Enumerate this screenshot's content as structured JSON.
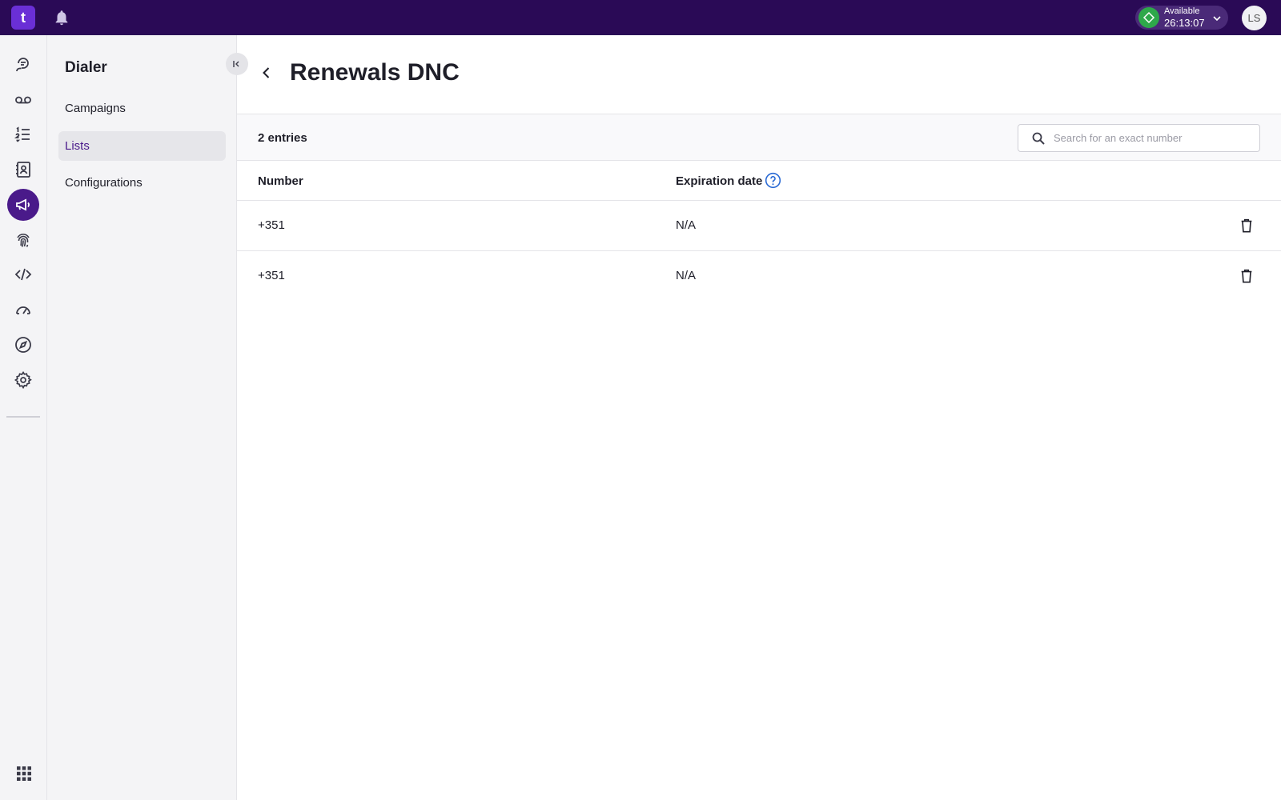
{
  "topbar": {
    "logo_text": "t",
    "status": {
      "label": "Available",
      "timer": "26:13:07",
      "color": "#2ea84a"
    },
    "avatar_initials": "LS",
    "brand_color": "#2a0a56",
    "icons": [
      "bell-icon",
      "chevron-down-icon"
    ]
  },
  "rail": {
    "items": [
      {
        "name": "conversations-icon",
        "active": false
      },
      {
        "name": "voicemail-icon",
        "active": false
      },
      {
        "name": "lists-icon",
        "active": false
      },
      {
        "name": "contacts-icon",
        "active": false
      },
      {
        "name": "dialer-megaphone-icon",
        "active": true
      },
      {
        "name": "fingerprint-icon",
        "active": false
      },
      {
        "name": "code-icon",
        "active": false
      },
      {
        "name": "dashboard-gauge-icon",
        "active": false
      },
      {
        "name": "compass-icon",
        "active": false
      },
      {
        "name": "settings-gear-icon",
        "active": false
      }
    ],
    "bottom_icon": "apps-grid-icon",
    "active_color": "#4a1a8a"
  },
  "sidebar": {
    "title": "Dialer",
    "items": [
      {
        "label": "Campaigns",
        "active": false
      },
      {
        "label": "Lists",
        "active": true
      },
      {
        "label": "Configurations",
        "active": false
      }
    ]
  },
  "main": {
    "title": "Renewals DNC",
    "entries_label": "2 entries",
    "search": {
      "placeholder": "Search for an exact number",
      "value": ""
    },
    "table": {
      "columns": [
        "Number",
        "Expiration date"
      ],
      "rows": [
        {
          "number": "+351",
          "expiration": "N/A"
        },
        {
          "number": "+351",
          "expiration": "N/A"
        }
      ]
    },
    "help_color": "#2a6ad4"
  }
}
